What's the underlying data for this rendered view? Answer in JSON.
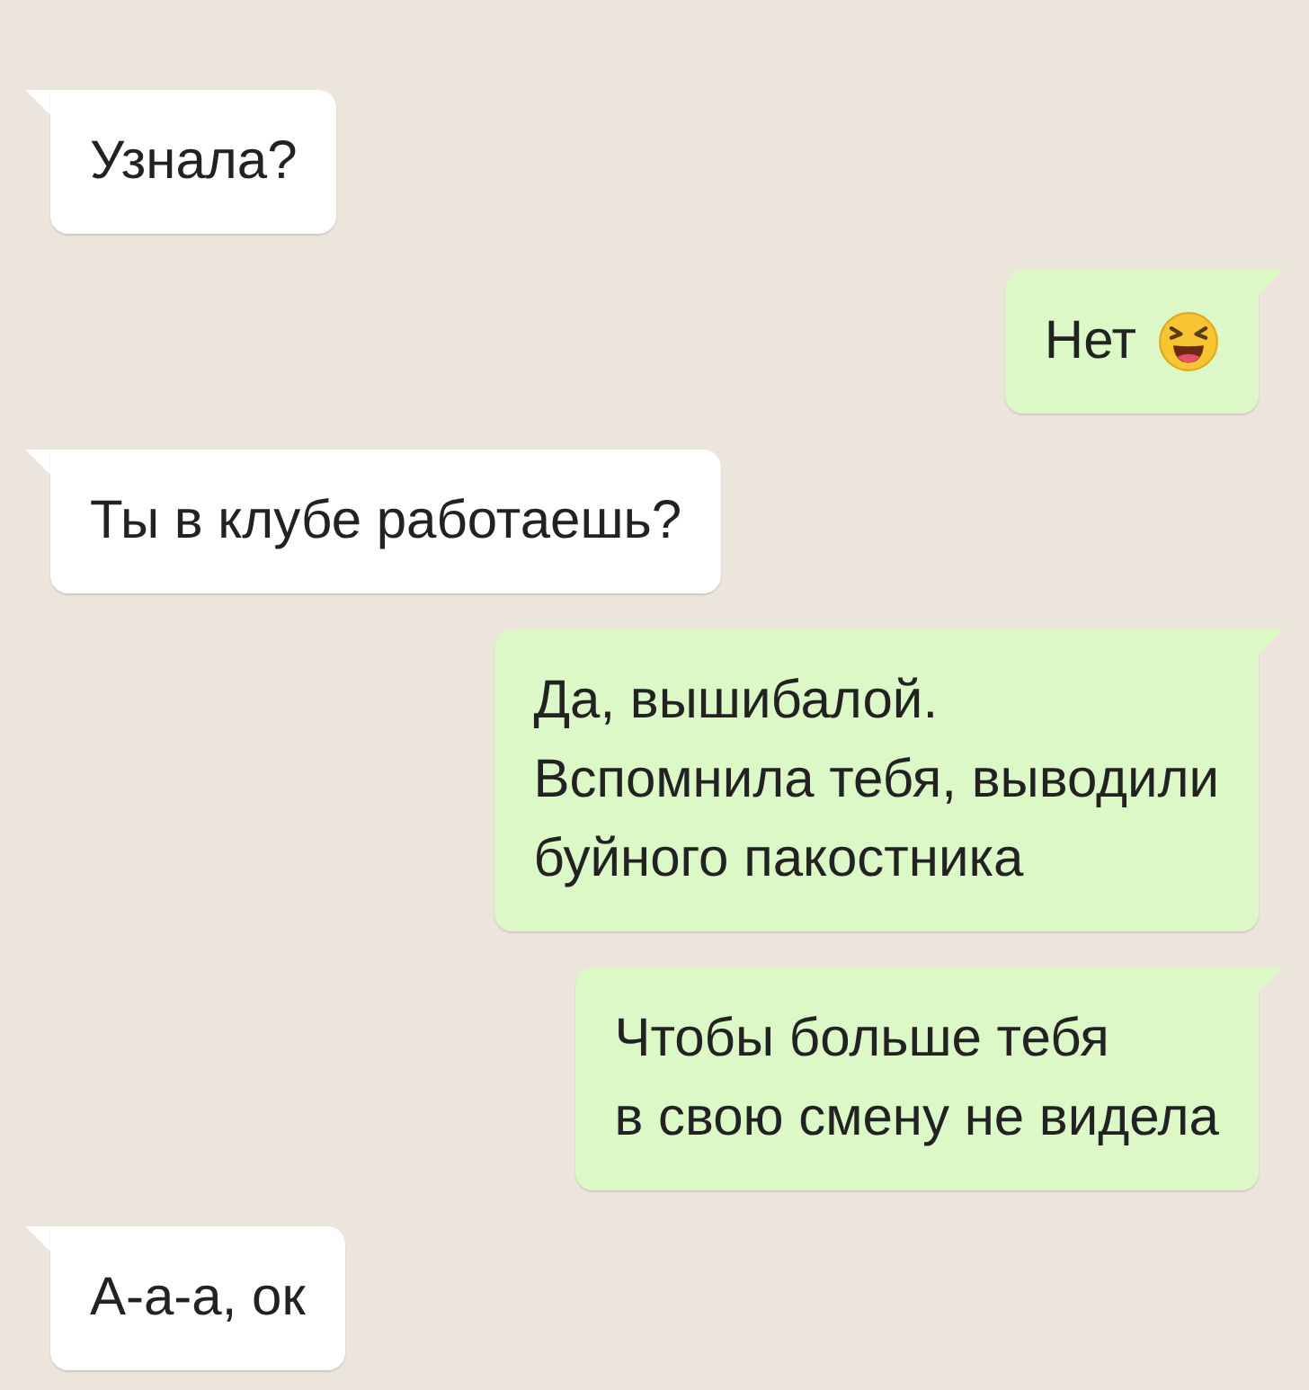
{
  "messages": [
    {
      "kind": "in",
      "text": "Узнала?"
    },
    {
      "kind": "out",
      "text": "Нет",
      "emoji": true
    },
    {
      "kind": "in",
      "text": "Ты в клубе работаешь?"
    },
    {
      "kind": "out",
      "text": "Да, вышибалой.\nВспомнила тебя, выводили\nбуйного пакостника"
    },
    {
      "kind": "out",
      "text": "Чтобы больше тебя\nв свою смену не видела"
    },
    {
      "kind": "in",
      "text": "А-а-а, ок"
    }
  ]
}
